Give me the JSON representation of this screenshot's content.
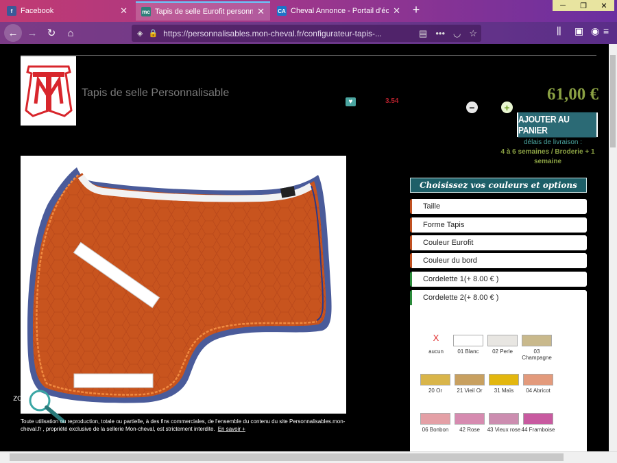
{
  "browser": {
    "tabs": [
      {
        "favicon": "f",
        "favicon_color": "#3b5998",
        "title": "Facebook"
      },
      {
        "favicon": "mc",
        "favicon_color": "#2f7f7a",
        "title": "Tapis de selle Eurofit personnal"
      },
      {
        "favicon": "CA",
        "favicon_color": "#1e73c8",
        "title": "Cheval Annonce - Portail d'éch"
      }
    ],
    "url": "https://personnalisables.mon-cheval.fr/configurateur-tapis-..."
  },
  "product": {
    "title": "Tapis de selle Personnalisable",
    "score": "3.54",
    "price": "61,00 €",
    "qty_minus": "−",
    "qty_plus": "+",
    "add_to_cart": "AJOUTER AU PANIER",
    "delivery_label": "délais de livraison :",
    "delivery_value": "4 à 6 semaines / Broderie + 1 semaine"
  },
  "image": {
    "zoom_label": "zoom",
    "copyright": "Toute utilisation ou reproduction, totale ou partielle, à des fins commerciales, de l'ensemble du contenu du site Personnalisables.mon-cheval.fr , propriété exclusive de la sellerie Mon-cheval, est strictement interdite.",
    "more_link": "En savoir +"
  },
  "options": {
    "header": "Choisissez vos couleurs et options",
    "items": [
      {
        "label": "Taille"
      },
      {
        "label": "Forme Tapis"
      },
      {
        "label": "Couleur Eurofit"
      },
      {
        "label": "Couleur du bord"
      },
      {
        "label": "Cordelette 1(+ 8.00 € )"
      },
      {
        "label": "Cordelette 2(+ 8.00 € )"
      }
    ]
  },
  "swatches": [
    {
      "label": "aucun",
      "color": "none"
    },
    {
      "label": "01 Blanc",
      "color": "#ffffff"
    },
    {
      "label": "02 Perle",
      "color": "#e8e6e2"
    },
    {
      "label": "03 Champagne",
      "color": "#c9b98c"
    },
    {
      "label": "20 Or",
      "color": "#d9b54a"
    },
    {
      "label": "21 Vieil Or",
      "color": "#c8a060"
    },
    {
      "label": "31 Maïs",
      "color": "#e3b70e"
    },
    {
      "label": "04 Abricot",
      "color": "#e39a7c"
    },
    {
      "label": "06 Bonbon",
      "color": "#e4a0a6"
    },
    {
      "label": "42 Rose",
      "color": "#d68bb0"
    },
    {
      "label": "43 Vieux rose",
      "color": "#cc8db0"
    },
    {
      "label": "44 Framboise",
      "color": "#c85aa0"
    }
  ],
  "colors": {
    "accent_teal": "#2b6a75",
    "price_green": "#8aa043",
    "pad_orange": "#c8541e",
    "pad_border": "#4a5b9a"
  }
}
